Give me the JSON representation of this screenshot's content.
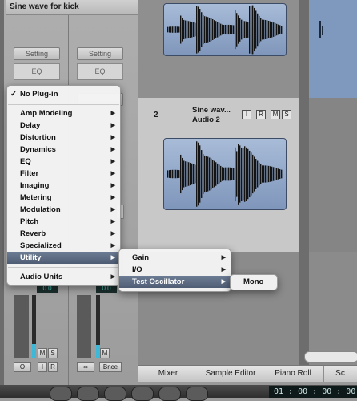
{
  "strip": {
    "name": "Sine wave for kick",
    "setting_left": "Setting",
    "setting_right": "Setting",
    "eq_left": "EQ",
    "eq_right": "EQ",
    "display_left": "0.0",
    "display_right": "0.0",
    "m_label": "M",
    "s_label": "S",
    "o_label": "O",
    "i_label": "I",
    "r_label": "R",
    "bnce_label": "Bnce",
    "meter_level_left": 0.22,
    "meter_level_right": 0.2
  },
  "track": {
    "number": "2",
    "title": "Sine wav...",
    "subtitle": "Audio 2",
    "btn_i": "I",
    "btn_r": "R",
    "btn_m": "M",
    "btn_s": "S"
  },
  "tabs": [
    "Mixer",
    "Sample Editor",
    "Piano Roll",
    "Sc"
  ],
  "menu": {
    "check": "✓",
    "no_plugin": "No Plug-in",
    "items": [
      "Amp Modeling",
      "Delay",
      "Distortion",
      "Dynamics",
      "EQ",
      "Filter",
      "Imaging",
      "Metering",
      "Modulation",
      "Pitch",
      "Reverb",
      "Specialized",
      "Utility"
    ],
    "audio_units": "Audio Units",
    "highlighted": "Utility"
  },
  "submenu": {
    "items": [
      "Gain",
      "I/O",
      "Test Oscillator"
    ],
    "highlighted": "Test Oscillator"
  },
  "subsubmenu": {
    "items": [
      "Mono"
    ]
  },
  "transport": {
    "time": "01 : 00 : 00 : 00"
  },
  "colors": {
    "highlight": "#56657c",
    "region": "#8ea4c6",
    "meter": "#3fb8d8"
  }
}
